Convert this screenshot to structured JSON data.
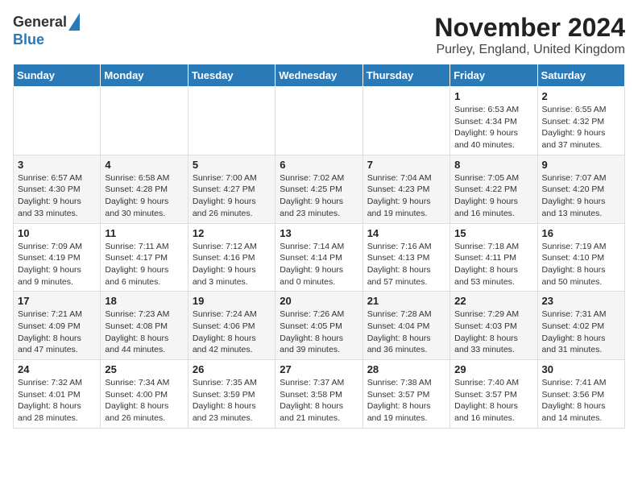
{
  "logo": {
    "general": "General",
    "blue": "Blue"
  },
  "title": "November 2024",
  "location": "Purley, England, United Kingdom",
  "days_of_week": [
    "Sunday",
    "Monday",
    "Tuesday",
    "Wednesday",
    "Thursday",
    "Friday",
    "Saturday"
  ],
  "weeks": [
    [
      {
        "day": "",
        "info": ""
      },
      {
        "day": "",
        "info": ""
      },
      {
        "day": "",
        "info": ""
      },
      {
        "day": "",
        "info": ""
      },
      {
        "day": "",
        "info": ""
      },
      {
        "day": "1",
        "info": "Sunrise: 6:53 AM\nSunset: 4:34 PM\nDaylight: 9 hours\nand 40 minutes."
      },
      {
        "day": "2",
        "info": "Sunrise: 6:55 AM\nSunset: 4:32 PM\nDaylight: 9 hours\nand 37 minutes."
      }
    ],
    [
      {
        "day": "3",
        "info": "Sunrise: 6:57 AM\nSunset: 4:30 PM\nDaylight: 9 hours\nand 33 minutes."
      },
      {
        "day": "4",
        "info": "Sunrise: 6:58 AM\nSunset: 4:28 PM\nDaylight: 9 hours\nand 30 minutes."
      },
      {
        "day": "5",
        "info": "Sunrise: 7:00 AM\nSunset: 4:27 PM\nDaylight: 9 hours\nand 26 minutes."
      },
      {
        "day": "6",
        "info": "Sunrise: 7:02 AM\nSunset: 4:25 PM\nDaylight: 9 hours\nand 23 minutes."
      },
      {
        "day": "7",
        "info": "Sunrise: 7:04 AM\nSunset: 4:23 PM\nDaylight: 9 hours\nand 19 minutes."
      },
      {
        "day": "8",
        "info": "Sunrise: 7:05 AM\nSunset: 4:22 PM\nDaylight: 9 hours\nand 16 minutes."
      },
      {
        "day": "9",
        "info": "Sunrise: 7:07 AM\nSunset: 4:20 PM\nDaylight: 9 hours\nand 13 minutes."
      }
    ],
    [
      {
        "day": "10",
        "info": "Sunrise: 7:09 AM\nSunset: 4:19 PM\nDaylight: 9 hours\nand 9 minutes."
      },
      {
        "day": "11",
        "info": "Sunrise: 7:11 AM\nSunset: 4:17 PM\nDaylight: 9 hours\nand 6 minutes."
      },
      {
        "day": "12",
        "info": "Sunrise: 7:12 AM\nSunset: 4:16 PM\nDaylight: 9 hours\nand 3 minutes."
      },
      {
        "day": "13",
        "info": "Sunrise: 7:14 AM\nSunset: 4:14 PM\nDaylight: 9 hours\nand 0 minutes."
      },
      {
        "day": "14",
        "info": "Sunrise: 7:16 AM\nSunset: 4:13 PM\nDaylight: 8 hours\nand 57 minutes."
      },
      {
        "day": "15",
        "info": "Sunrise: 7:18 AM\nSunset: 4:11 PM\nDaylight: 8 hours\nand 53 minutes."
      },
      {
        "day": "16",
        "info": "Sunrise: 7:19 AM\nSunset: 4:10 PM\nDaylight: 8 hours\nand 50 minutes."
      }
    ],
    [
      {
        "day": "17",
        "info": "Sunrise: 7:21 AM\nSunset: 4:09 PM\nDaylight: 8 hours\nand 47 minutes."
      },
      {
        "day": "18",
        "info": "Sunrise: 7:23 AM\nSunset: 4:08 PM\nDaylight: 8 hours\nand 44 minutes."
      },
      {
        "day": "19",
        "info": "Sunrise: 7:24 AM\nSunset: 4:06 PM\nDaylight: 8 hours\nand 42 minutes."
      },
      {
        "day": "20",
        "info": "Sunrise: 7:26 AM\nSunset: 4:05 PM\nDaylight: 8 hours\nand 39 minutes."
      },
      {
        "day": "21",
        "info": "Sunrise: 7:28 AM\nSunset: 4:04 PM\nDaylight: 8 hours\nand 36 minutes."
      },
      {
        "day": "22",
        "info": "Sunrise: 7:29 AM\nSunset: 4:03 PM\nDaylight: 8 hours\nand 33 minutes."
      },
      {
        "day": "23",
        "info": "Sunrise: 7:31 AM\nSunset: 4:02 PM\nDaylight: 8 hours\nand 31 minutes."
      }
    ],
    [
      {
        "day": "24",
        "info": "Sunrise: 7:32 AM\nSunset: 4:01 PM\nDaylight: 8 hours\nand 28 minutes."
      },
      {
        "day": "25",
        "info": "Sunrise: 7:34 AM\nSunset: 4:00 PM\nDaylight: 8 hours\nand 26 minutes."
      },
      {
        "day": "26",
        "info": "Sunrise: 7:35 AM\nSunset: 3:59 PM\nDaylight: 8 hours\nand 23 minutes."
      },
      {
        "day": "27",
        "info": "Sunrise: 7:37 AM\nSunset: 3:58 PM\nDaylight: 8 hours\nand 21 minutes."
      },
      {
        "day": "28",
        "info": "Sunrise: 7:38 AM\nSunset: 3:57 PM\nDaylight: 8 hours\nand 19 minutes."
      },
      {
        "day": "29",
        "info": "Sunrise: 7:40 AM\nSunset: 3:57 PM\nDaylight: 8 hours\nand 16 minutes."
      },
      {
        "day": "30",
        "info": "Sunrise: 7:41 AM\nSunset: 3:56 PM\nDaylight: 8 hours\nand 14 minutes."
      }
    ]
  ]
}
